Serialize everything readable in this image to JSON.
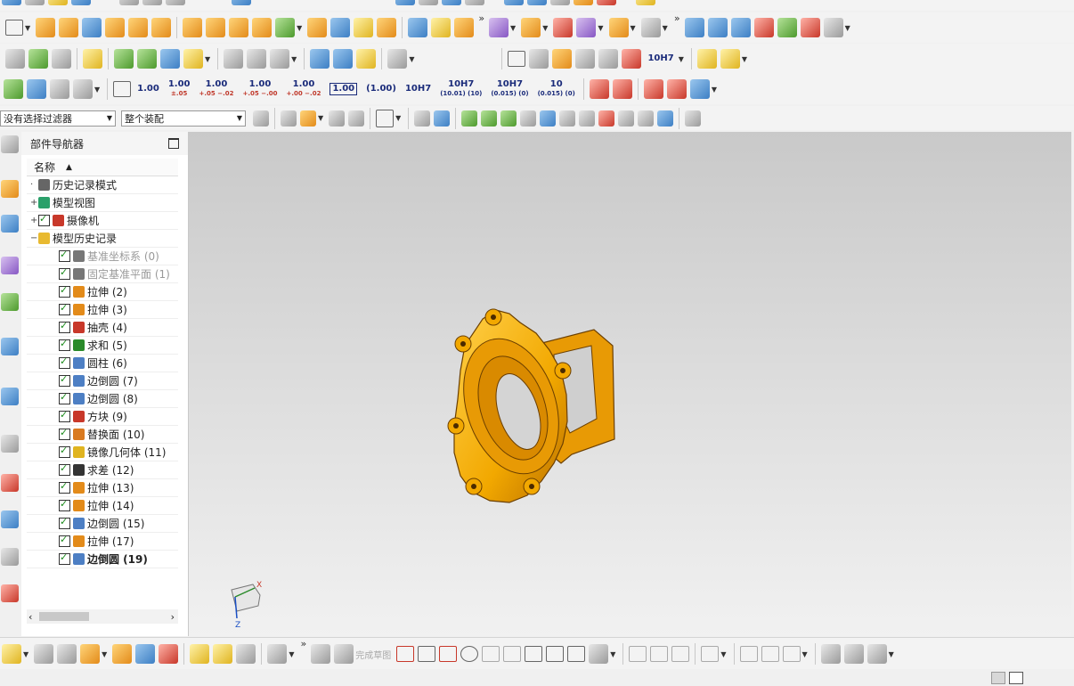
{
  "filter": {
    "selection_filter": "没有选择过滤器",
    "assembly_scope": "整个装配"
  },
  "dims": {
    "d1": {
      "main": "1.00",
      "sub": ""
    },
    "d2": {
      "main": "1.00",
      "sub": "±.05"
    },
    "d3": {
      "main": "1.00",
      "sub": "+.05 −.02"
    },
    "d4": {
      "main": "1.00",
      "sub": "+.05 −.00"
    },
    "d5": {
      "main": "1.00",
      "sub": "+.00 −.02"
    },
    "d6": "1.00",
    "d7": "(1.00)",
    "d8": "10H7",
    "d9": {
      "main": "10H7",
      "sub": "(10.01) (10)"
    },
    "d10": {
      "main": "10H7",
      "sub": "(0.015) (0)"
    },
    "d11": {
      "main": "10",
      "sub": "(0.015) (0)"
    },
    "d12": "10H7"
  },
  "navigator": {
    "title": "部件导航器",
    "column_name": "名称",
    "items": [
      {
        "label": "历史记录模式",
        "level": 0,
        "check": false,
        "icon": "clock-icon",
        "color": "#666666",
        "expand": ""
      },
      {
        "label": "模型视图",
        "level": 0,
        "check": false,
        "icon": "model-view-icon",
        "color": "#2aa06a",
        "expand": "+"
      },
      {
        "label": "摄像机",
        "level": 0,
        "check": true,
        "icon": "camera-icon",
        "color": "#c8382a",
        "expand": "+"
      },
      {
        "label": "模型历史记录",
        "level": 0,
        "check": false,
        "icon": "folder-icon",
        "color": "#e8b930",
        "expand": "−"
      },
      {
        "label": "基准坐标系 (0)",
        "level": 1,
        "check": true,
        "icon": "datum-csys-icon",
        "color": "#777777",
        "dim": true
      },
      {
        "label": "固定基准平面 (1)",
        "level": 1,
        "check": true,
        "icon": "datum-plane-icon",
        "color": "#777777",
        "dim": true
      },
      {
        "label": "拉伸 (2)",
        "level": 1,
        "check": true,
        "icon": "extrude-icon",
        "color": "#e38b1a"
      },
      {
        "label": "拉伸 (3)",
        "level": 1,
        "check": true,
        "icon": "extrude-icon",
        "color": "#e38b1a"
      },
      {
        "label": "抽壳 (4)",
        "level": 1,
        "check": true,
        "icon": "shell-icon",
        "color": "#c8382a"
      },
      {
        "label": "求和 (5)",
        "level": 1,
        "check": true,
        "icon": "unite-icon",
        "color": "#2a8a2a"
      },
      {
        "label": "圆柱 (6)",
        "level": 1,
        "check": true,
        "icon": "cylinder-icon",
        "color": "#4d7fc4"
      },
      {
        "label": "边倒圆 (7)",
        "level": 1,
        "check": true,
        "icon": "edge-blend-icon",
        "color": "#4d7fc4"
      },
      {
        "label": "边倒圆 (8)",
        "level": 1,
        "check": true,
        "icon": "edge-blend-icon",
        "color": "#4d7fc4"
      },
      {
        "label": "方块 (9)",
        "level": 1,
        "check": true,
        "icon": "block-icon",
        "color": "#c8382a"
      },
      {
        "label": "替换面 (10)",
        "level": 1,
        "check": true,
        "icon": "replace-face-icon",
        "color": "#d97a20"
      },
      {
        "label": "镜像几何体 (11)",
        "level": 1,
        "check": true,
        "icon": "mirror-geometry-icon",
        "color": "#e0b420"
      },
      {
        "label": "求差 (12)",
        "level": 1,
        "check": true,
        "icon": "subtract-icon",
        "color": "#333333"
      },
      {
        "label": "拉伸 (13)",
        "level": 1,
        "check": true,
        "icon": "extrude-icon",
        "color": "#e38b1a"
      },
      {
        "label": "拉伸 (14)",
        "level": 1,
        "check": true,
        "icon": "extrude-icon",
        "color": "#e38b1a"
      },
      {
        "label": "边倒圆 (15)",
        "level": 1,
        "check": true,
        "icon": "edge-blend-icon",
        "color": "#4d7fc4"
      },
      {
        "label": "拉伸 (17)",
        "level": 1,
        "check": true,
        "icon": "extrude-icon",
        "color": "#e38b1a"
      },
      {
        "label": "边倒圆 (19)",
        "level": 1,
        "check": true,
        "icon": "edge-blend-icon",
        "color": "#4d7fc4",
        "bold": true
      }
    ]
  },
  "sketch": {
    "finish_label": "完成草图"
  },
  "triad": {
    "x": "X",
    "z": "Z"
  },
  "colors": {
    "part": "#f2a800",
    "part_dark": "#b86e00",
    "viewport_top": "#c9c9c9",
    "viewport_bottom": "#f1f1f1"
  }
}
